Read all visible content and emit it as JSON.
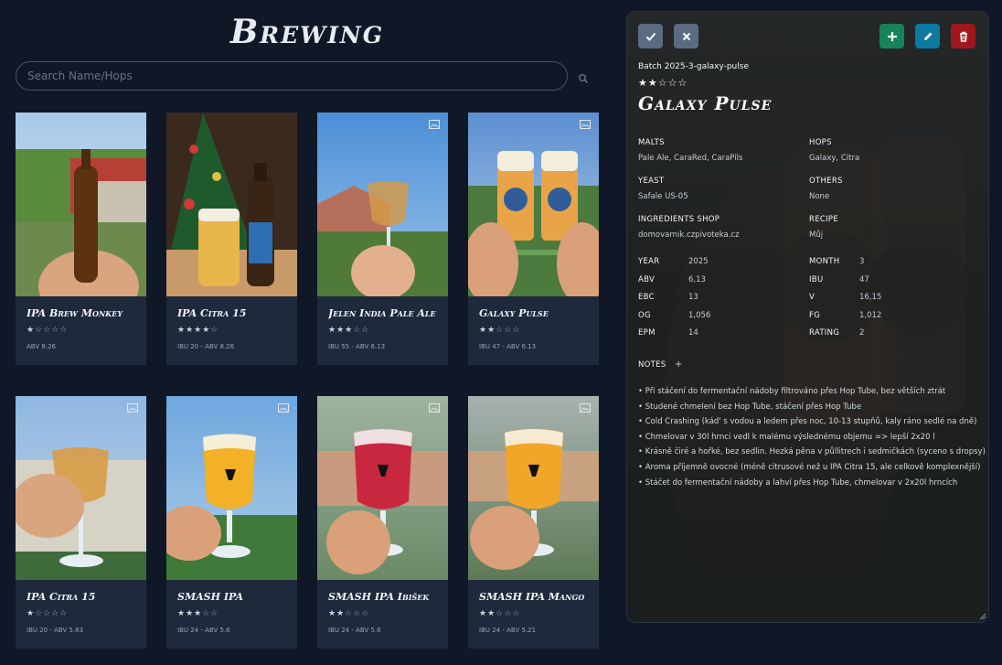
{
  "app": {
    "title": "Brewing"
  },
  "search": {
    "placeholder": "Search Name/Hops",
    "value": ""
  },
  "cards": [
    {
      "name": "IPA Brew Monkey",
      "stars_filled": "★",
      "stars_empty": "☆☆☆☆",
      "meta": "ABV 8.26",
      "photo": "bottle"
    },
    {
      "name": "IPA Citra 15",
      "stars_filled": "★★★★",
      "stars_empty": "☆",
      "meta": "IBU 20 - ABV 8.26",
      "photo": "xmas"
    },
    {
      "name": "Jelen India Pale Ale",
      "stars_filled": "★★★",
      "stars_empty": "☆☆",
      "meta": "IBU 55 - ABV 6.13",
      "photo": "glass-sky"
    },
    {
      "name": "Galaxy Pulse",
      "stars_filled": "★★",
      "stars_empty": "☆☆☆",
      "meta": "IBU 47 - ABV 6.13",
      "photo": "cheers"
    },
    {
      "name": "IPA Citra 15",
      "stars_filled": "★",
      "stars_empty": "☆☆☆☆",
      "meta": "IBU 20 - ABV 5.83",
      "photo": "glass-amber"
    },
    {
      "name": "SMASH IPA",
      "stars_filled": "★★★",
      "stars_empty": "☆☆",
      "meta": "IBU 24 - ABV 5.6",
      "photo": "lucky-yellow"
    },
    {
      "name": "SMASH IPA Ibišek",
      "stars_filled": "★★",
      "stars_empty": "☆☆☆",
      "meta": "IBU 24 - ABV 5.6",
      "photo": "lucky-red"
    },
    {
      "name": "SMASH IPA Mango",
      "stars_filled": "★★",
      "stars_empty": "☆☆☆",
      "meta": "IBU 24 - ABV 5.21",
      "photo": "lucky-orange"
    }
  ],
  "detail": {
    "batch": "Batch 2025-3-galaxy-pulse",
    "stars_filled": "★★",
    "stars_empty": "☆☆☆",
    "name": "Galaxy Pulse",
    "labels": {
      "malts": "MALTS",
      "hops": "HOPS",
      "yeast": "YEAST",
      "others": "OTHERS",
      "shop": "INGREDIENTS SHOP",
      "recipe": "RECIPE",
      "year": "YEAR",
      "month": "MONTH",
      "abv": "ABV",
      "ibu": "IBU",
      "ebc": "EBC",
      "v": "V",
      "og": "OG",
      "fg": "FG",
      "epm": "EPM",
      "rating": "RATING",
      "notes": "NOTES",
      "notes_add": "+"
    },
    "malts": "Pale Ale, CaraRed, CaraPils",
    "hops": "Galaxy, Citra",
    "yeast": "Safale US-05",
    "others": "None",
    "shop": "domovarnik.czpivoteka.cz",
    "recipe": "Můj",
    "year": "2025",
    "month": "3",
    "abv": "6,13",
    "ibu": "47",
    "ebc": "13",
    "v": "16,15",
    "og": "1,056",
    "fg": "1,012",
    "epm": "14",
    "rating": "2",
    "notes": [
      "• Při stáčení do fermentační nádoby filtrováno přes Hop Tube, bez větších ztrát",
      "• Studené chmelení bez Hop Tube, stáčení přes Hop Tube",
      "• Cold Crashing (kád' s vodou a ledem přes noc, 10-13 stupňů, kaly ráno sedlé na dně)",
      "• Chmelovar v 30l hrnci vedl k malému výslednému objemu => lepší 2x20 l",
      "• Krásně čiré a hořké, bez sedlin. Hezká pěna v půllitrech i sedmičkách (syceno s dropsy)",
      "• Aroma příjemně ovocné (méně citrusové než u IPA Citra 15, ale celkově komplexnější)",
      "• Stáčet do fermentační nádoby a lahví přes Hop Tube, chmelovar v 2x20l hrncích"
    ]
  },
  "colors": {
    "background": "#101828",
    "card": "#1e293b",
    "approve_button": "#5a6b82",
    "add_button": "#16835a",
    "edit_button": "#0e7aa1",
    "delete_button": "#a1161c"
  },
  "icons": [
    "search-icon",
    "image-icon",
    "check-icon",
    "close-icon",
    "plus-icon",
    "pencil-icon",
    "trash-icon"
  ]
}
